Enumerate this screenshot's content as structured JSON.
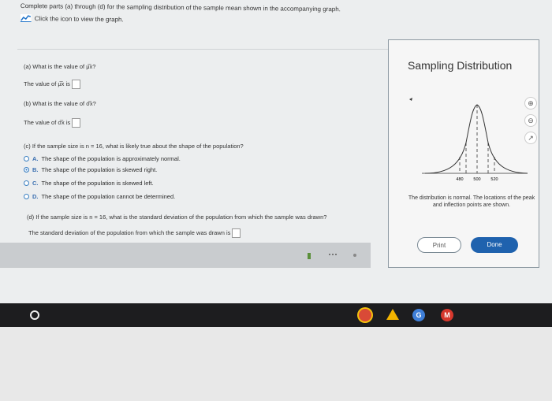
{
  "instructions": {
    "line1": "Complete parts (a) through (d) for the sampling distribution of the sample mean shown in the accompanying graph.",
    "link": "Click the icon to view the graph."
  },
  "part_a": {
    "question": "(a) What is the value of μ̅x?",
    "answer_prefix": "The value of μ̅x is"
  },
  "part_b": {
    "question": "(b) What is the value of σ̅x?",
    "answer_prefix": "The value of σ̅x is"
  },
  "part_c": {
    "question": "(c) If the sample size is n = 16, what is likely true about the shape of the population?",
    "options": [
      {
        "letter": "A.",
        "text": "The shape of the population is approximately normal."
      },
      {
        "letter": "B.",
        "text": "The shape of the population is skewed right."
      },
      {
        "letter": "C.",
        "text": "The shape of the population is skewed left."
      },
      {
        "letter": "D.",
        "text": "The shape of the population cannot be determined."
      }
    ],
    "selected_index": 1
  },
  "part_d": {
    "question": "(d) If the sample size is n = 16, what is the standard deviation of the population from which the sample was drawn?",
    "answer_prefix": "The standard deviation of the population from which the sample was drawn is"
  },
  "panel": {
    "title": "Sampling Distribution",
    "axis_ticks": [
      "480",
      "500",
      "520"
    ],
    "caption": "The distribution is normal. The locations of the peak and inflection points are shown.",
    "print_label": "Print",
    "done_label": "Done"
  }
}
